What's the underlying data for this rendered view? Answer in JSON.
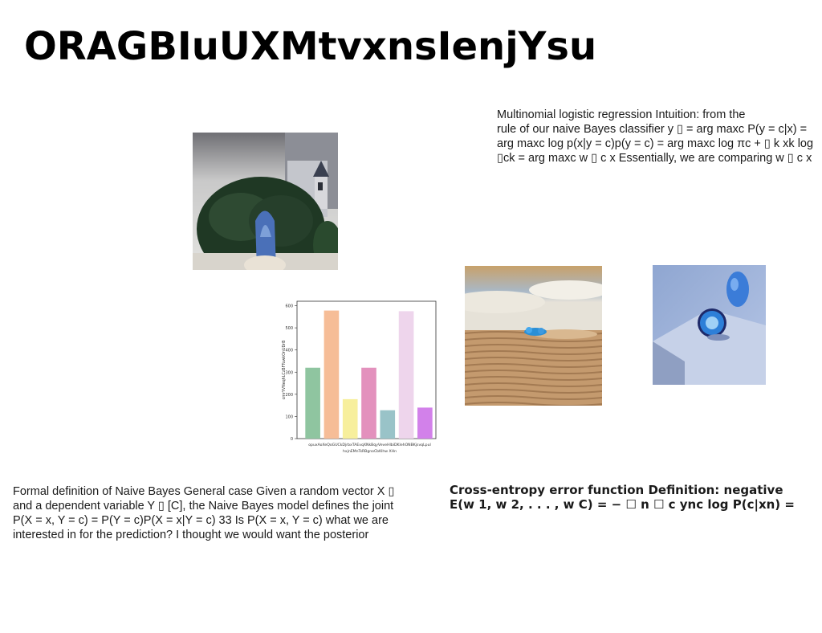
{
  "title": "ORAGBIuUXMtvxnsIenjYsu",
  "text_top_right": {
    "lines": [
      "Multinomial logistic regression Intuition: from the",
      "rule of our naive Bayes classifier y ▯ = arg maxc P(y = c|x) =",
      "arg maxc log p(x|y = c)p(y = c) = arg maxc log πc + ▯ k xk log",
      "▯ck = arg maxc w ▯ c x Essentially, we are comparing w ▯ c x"
    ]
  },
  "text_bottom_left": {
    "lines": [
      "Formal definition of Naive Bayes General case Given a random vector X ▯",
      "and a dependent variable Y ▯ [C], the Naive Bayes model defines the joint",
      "P(X = x, Y = c) = P(Y = c)P(X = x|Y = c) 33 Is P(X = x, Y = c) what we are",
      "interested in for the prediction? I thought we would want the posterior"
    ]
  },
  "text_bottom_right": {
    "lines": [
      "Cross-entropy error function Definition: negative",
      "E(w 1, w 2, . . . , w C) = − ☐ n ☐ c ync log P(c|xn) ="
    ]
  },
  "chart_data": {
    "type": "bar",
    "categories": [
      "opuxAoXeQo",
      "GUCkDjrbxT",
      "AEv",
      "qXNkBqyVeveHlb",
      "hxjnEMnTsRBgnoCbKlhw",
      "MaDKlehONBK",
      "XHn",
      "jsvqLpul"
    ],
    "tick_labels_row1": [
      "opuxAoXeQo",
      "GUCkDjrbxT",
      "AEv",
      "qXNkB",
      "qyVeveHlbi",
      "DKlehONB",
      "Kjsvq",
      "Lpul"
    ],
    "tick_labels_row2": [
      "hxjnEMnTsRBgnoCbKlhw",
      "XHn"
    ],
    "values": [
      320,
      578,
      178,
      320,
      128,
      575,
      140
    ],
    "colors": [
      "#8fc5a0",
      "#f6bd97",
      "#f7ef9c",
      "#e391bd",
      "#99c3c8",
      "#eed5ec",
      "#d281ea"
    ],
    "ylabel": "cmrYVNeqhLCzBFTuwkOnUDrB",
    "yticks": [
      0,
      100,
      200,
      300,
      400,
      500,
      600
    ],
    "ylim": [
      0,
      620
    ]
  }
}
